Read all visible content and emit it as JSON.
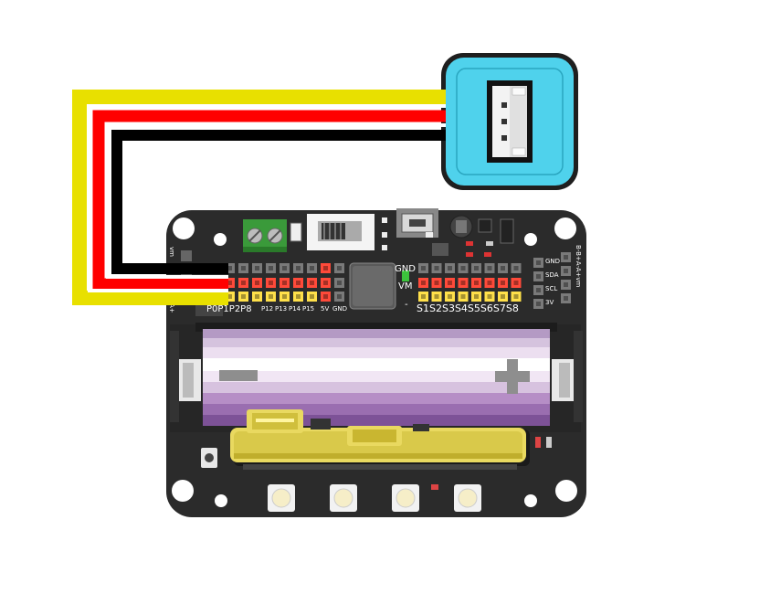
{
  "diagram": {
    "wires": [
      {
        "name": "yellow-wire",
        "color": "#e8e000"
      },
      {
        "name": "red-wire",
        "color": "#ff0000"
      },
      {
        "name": "black-wire",
        "color": "#000000"
      }
    ],
    "sensor_module": {
      "color": "#4fd2ec",
      "connector": "4-pin"
    },
    "board": {
      "color": "#2b2b2b",
      "left_edge_label": "vm",
      "left_edge_label2": "A+",
      "left_pins_label": "P0P1P2P8",
      "small_pin_labels": [
        "P12",
        "P13",
        "P14",
        "P15"
      ],
      "power_labels": [
        "5V",
        "GND"
      ],
      "center_labels": [
        "GND",
        "VM",
        "-"
      ],
      "servo_label": "S1S2S3S4S5S6S7S8",
      "right_labels": [
        "GND",
        "SDA",
        "SCL",
        "3V"
      ],
      "right_vertical_label": "B-B+A-A+vm",
      "battery_minus": "-",
      "battery_plus": "+"
    }
  }
}
